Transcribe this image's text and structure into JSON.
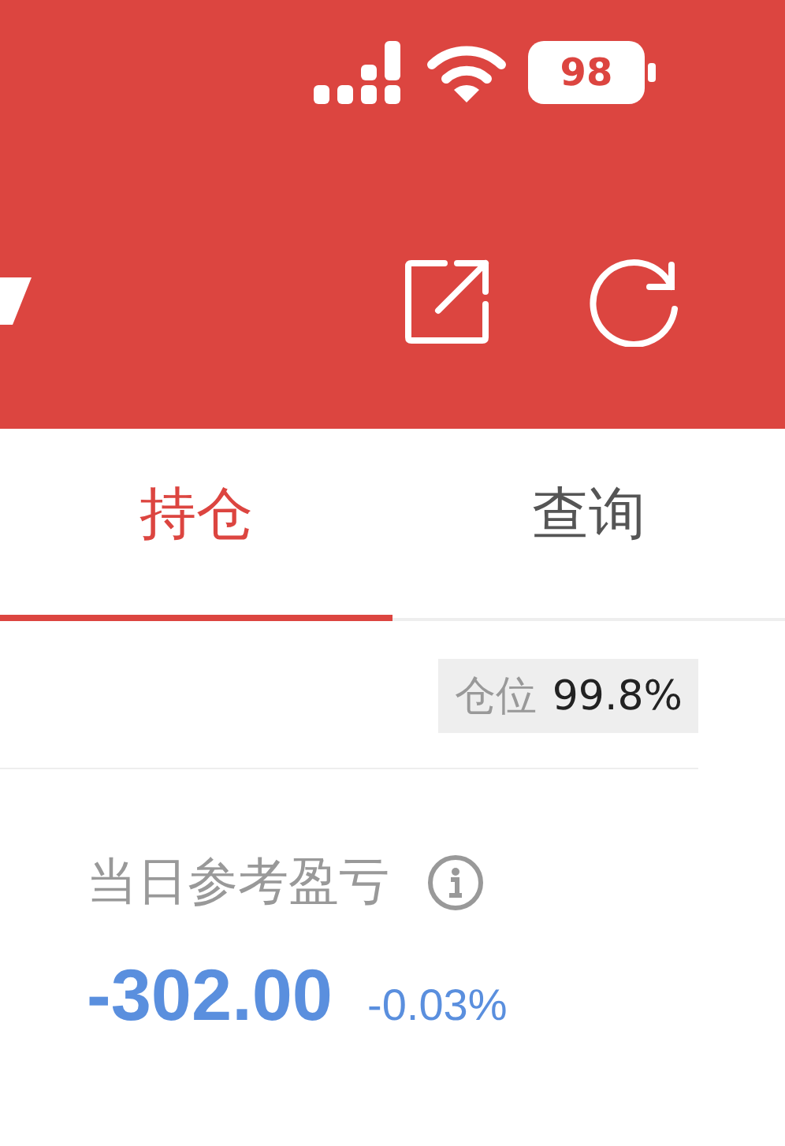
{
  "status_bar": {
    "battery": "98"
  },
  "tabs": [
    {
      "label": "持仓",
      "selected": true
    },
    {
      "label": "查询",
      "selected": false
    }
  ],
  "position": {
    "label": "仓位",
    "value": "99.8%"
  },
  "daily_pnl": {
    "label": "当日参考盈亏",
    "value": "-302.00",
    "percent": "-0.03%"
  }
}
